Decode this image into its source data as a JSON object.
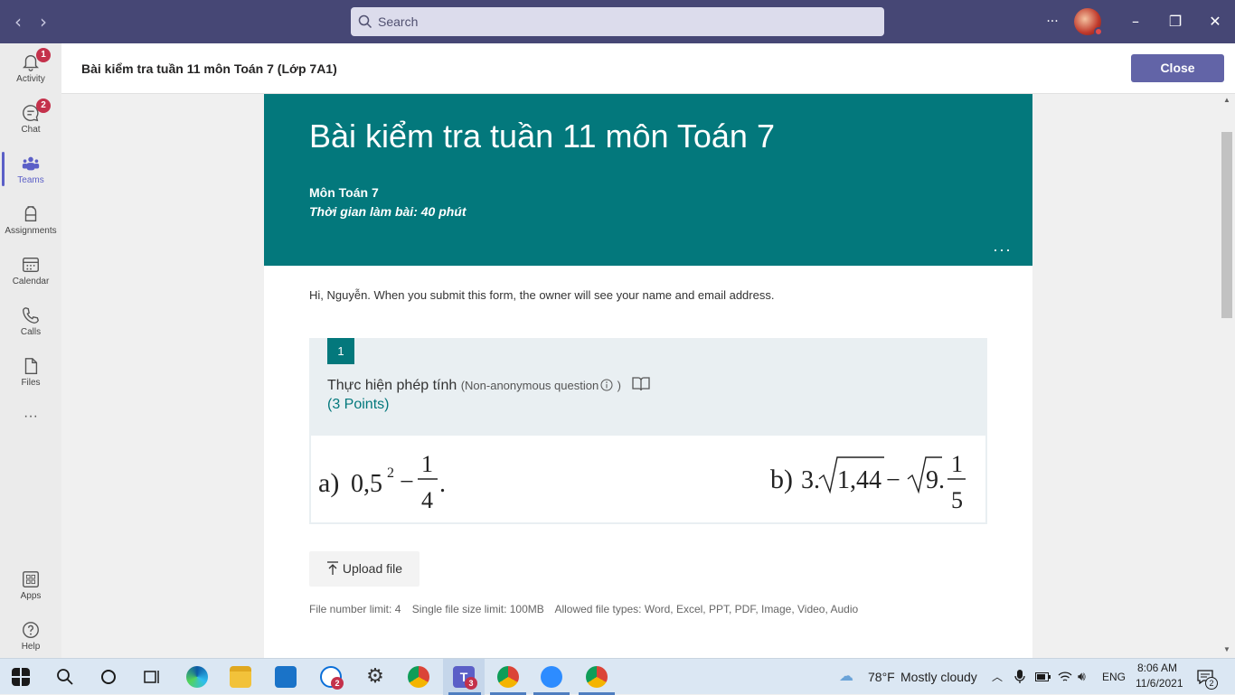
{
  "titlebar": {
    "search_placeholder": "Search",
    "more_label": "···"
  },
  "rail": {
    "items": [
      {
        "label": "Activity",
        "badge": "1"
      },
      {
        "label": "Chat",
        "badge": "2"
      },
      {
        "label": "Teams",
        "badge": ""
      },
      {
        "label": "Assignments",
        "badge": ""
      },
      {
        "label": "Calendar",
        "badge": ""
      },
      {
        "label": "Calls",
        "badge": ""
      },
      {
        "label": "Files",
        "badge": ""
      }
    ],
    "more_label": "···",
    "apps_label": "Apps",
    "help_label": "Help"
  },
  "header": {
    "title": "Bài kiểm tra tuần 11 môn Toán 7 (Lớp 7A1)",
    "close_label": "Close"
  },
  "form": {
    "title": "Bài kiểm tra tuần 11 môn Toán 7",
    "subject": "Môn Toán 7",
    "duration": "Thời gian làm bài: 40 phút",
    "more_label": "···",
    "greeting": "Hi, Nguyễn. When you submit this form, the owner will see your name and email address.",
    "question": {
      "number": "1",
      "text": "Thực hiện phép tính",
      "note": "(Non-anonymous question",
      "note_end": ")",
      "points": "(3 Points)",
      "part_a": "a)",
      "part_b": "b)"
    },
    "upload_label": "Upload file",
    "limits": {
      "count": "File number limit: 4",
      "size": "Single file size limit: 100MB",
      "types": "Allowed file types: Word, Excel, PPT, PDF, Image, Video, Audio"
    }
  },
  "taskbar": {
    "mail_badge": "2",
    "teams_badge": "3",
    "weather": "78°F",
    "weather_text": "Mostly cloudy",
    "lang": "ENG",
    "time": "8:06 AM",
    "date": "11/6/2021",
    "notif_count": "2"
  },
  "colors": {
    "titlebar": "#464775",
    "accent": "#03787c",
    "close_button": "#6264a7"
  }
}
